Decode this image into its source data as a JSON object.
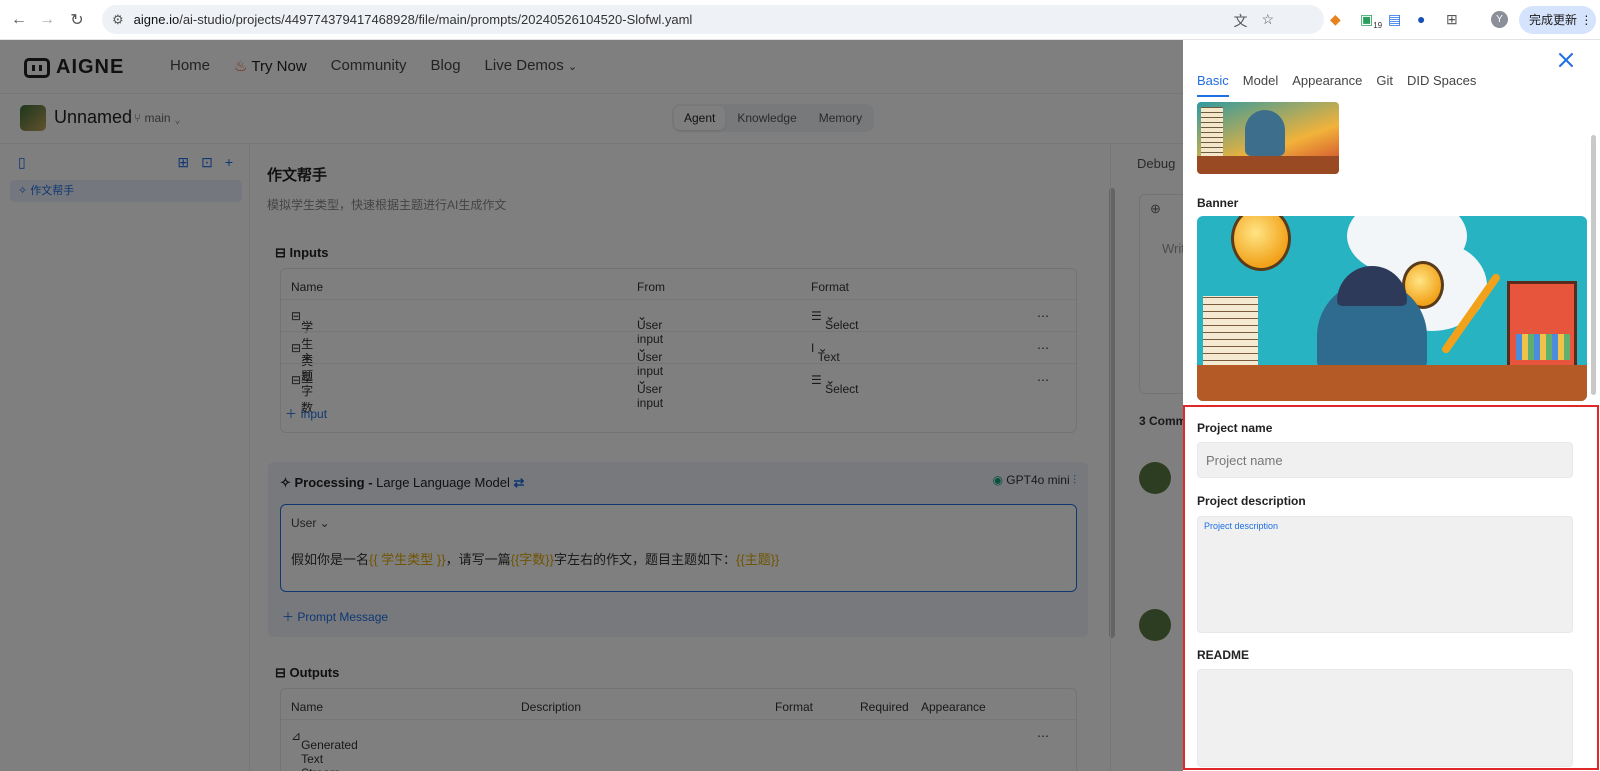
{
  "browser": {
    "url_host": "aigne.io",
    "url_path": "/ai-studio/projects/449774379417468928/file/main/prompts/20240526104520-Slofwl.yaml",
    "profile_initial": "Y",
    "update_label": "完成更新",
    "ext_badge": "19"
  },
  "nav": {
    "logo": "AIGNE",
    "items": [
      "Home",
      "Try Now",
      "Community",
      "Blog",
      "Live Demos"
    ]
  },
  "project": {
    "name": "Unnamed",
    "branch": "main",
    "segments": [
      "Agent",
      "Knowledge",
      "Memory"
    ]
  },
  "sidebar": {
    "item": "作文帮手"
  },
  "editor": {
    "title": "作文帮手",
    "subtitle": "模拟学生类型，快速根据主题进行AI生成作文",
    "inputs_label": "Inputs",
    "inputs_headers": [
      "Name",
      "From",
      "Format"
    ],
    "inputs_rows": [
      {
        "name": "学生类型",
        "from": "User input",
        "format": "Select"
      },
      {
        "name": "主题",
        "from": "User input",
        "format": "Text"
      },
      {
        "name": "字数",
        "from": "User input",
        "format": "Select"
      }
    ],
    "add_input": "Input",
    "processing_label": "Processing -",
    "processing_model": "Large Language Model",
    "model_chip": "GPT4o mini",
    "msg_role": "User",
    "msg_parts": [
      "假如你是一名",
      "{{ 学生类型 }}",
      "，请写一篇",
      "{{字数}}",
      "字左右的作文，题目主题如下：",
      "{{主题}}"
    ],
    "add_prompt": "Prompt Message",
    "outputs_label": "Outputs",
    "outputs_headers": [
      "Name",
      "Description",
      "Format",
      "Required",
      "Appearance"
    ],
    "outputs_row": "Generated Text Stream"
  },
  "debug": {
    "tab": "Debug",
    "placeholder": "Writ",
    "comments": "3 Comm"
  },
  "drawer": {
    "tabs": [
      "Basic",
      "Model",
      "Appearance",
      "Git",
      "DID Spaces"
    ],
    "banner_label": "Banner",
    "project_name_label": "Project name",
    "project_name_placeholder": "Project name",
    "project_desc_label": "Project description",
    "project_desc_placeholder": "Project description",
    "readme_label": "README"
  }
}
